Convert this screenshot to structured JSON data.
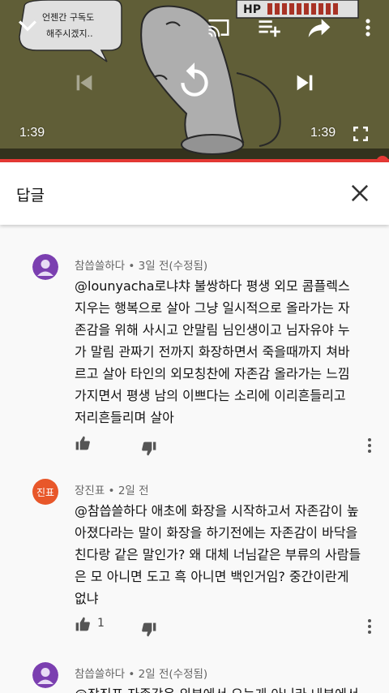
{
  "player": {
    "bubble_lines": [
      "언젠간 구독도",
      "해주시겠지.."
    ],
    "hp_label": "HP",
    "current_time": "1:39",
    "duration": "1:39",
    "progress": 1.0,
    "accent": "#e53935",
    "icons": [
      "chevron-down-icon",
      "cast-icon",
      "add-to-queue-icon",
      "share-icon",
      "more-vert-icon",
      "skip-previous-icon",
      "replay-icon",
      "skip-next-icon",
      "fullscreen-icon"
    ]
  },
  "panel": {
    "title": "답글",
    "close_icon": "close-icon"
  },
  "comments": [
    {
      "avatar_color": "#7b3fb0",
      "avatar_text": "",
      "author": "참씁쓸하다",
      "time": "3일 전(수정됨)",
      "lines": [
        "@lounyacha로냐챠 불쌍하다 평생 외모 콤플렉스",
        "지우는 행복으로 살아 그냥 일시적으로 올라가는 자",
        "존감을 위해 사시고 안말림 님인생이고 님자유야 누",
        "가 말림 관짜기 전까지 화장하면서 죽을때까지 쳐바",
        "르고 살아 타인의 외모칭찬에 자존감 올라가는 느낌",
        "가지면서 평생 남의 이쁘다는 소리에 이리흔들리고",
        "저리흔들리며 살아"
      ],
      "likes": ""
    },
    {
      "avatar_color": "#e8572a",
      "avatar_text": "진표",
      "author": "장진표",
      "time": "2일 전",
      "lines": [
        "@참씁쓸하다 애초에 화장을 시작하고서 자존감이 높",
        "아졌다라는 말이 화장을 하기전에는 자존감이 바닥을",
        "친다랑 같은 말인가? 왜 대체 너님같은 부류의 사람들",
        "은 모 아니면 도고 흑 아니면 백인거임? 중간이란게",
        "없냐"
      ],
      "likes": "1"
    },
    {
      "avatar_color": "#7b3fb0",
      "avatar_text": "",
      "author": "참씁쓸하다",
      "time": "2일 전(수정됨)",
      "lines": [
        "@장진표 자존감은 외부에서 오는게 아니라 내부에서"
      ],
      "likes": ""
    }
  ]
}
